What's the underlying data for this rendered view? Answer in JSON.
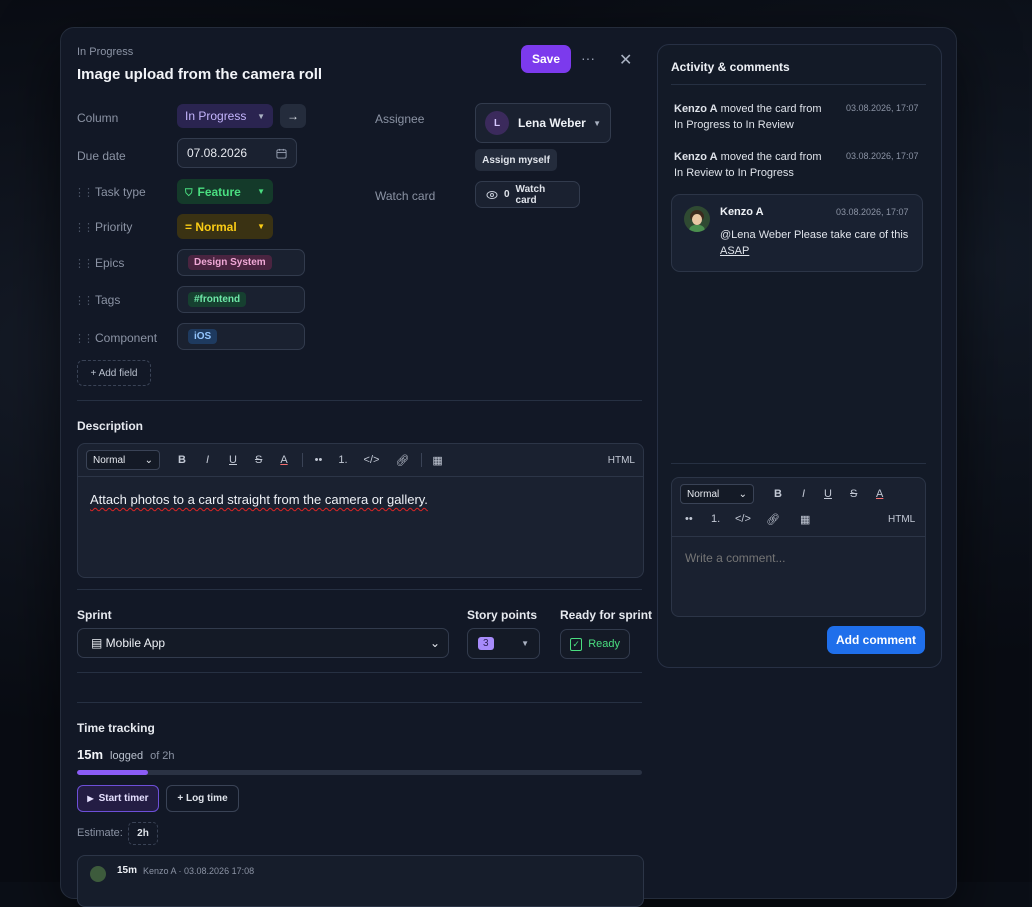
{
  "card": {
    "status": "In Progress",
    "title": "Image upload from the camera roll",
    "save_label": "Save",
    "more_label": "···",
    "close_label": "✕"
  },
  "fields": {
    "column_label": "Column",
    "column_value": "In Progress",
    "move_arrow": "→",
    "due_label": "Due date",
    "due_value": "07.08.2026",
    "task_type_label": "Task type",
    "task_type_value": "Feature",
    "priority_label": "Priority",
    "priority_value": "= Normal",
    "epics_label": "Epics",
    "epics_value": "Design System",
    "tags_label": "Tags",
    "tags_value": "#frontend",
    "component_label": "Component",
    "component_value": "iOS",
    "add_field_label": "+ Add field",
    "assignee_label": "Assignee",
    "assignee_initial": "L",
    "assignee_name": "Lena Weber",
    "assign_myself_label": "Assign myself",
    "watch_label": "Watch card",
    "watch_count": "0",
    "watch_button_label": "Watch card"
  },
  "description": {
    "title": "Description",
    "format_value": "Normal",
    "html_label": "HTML",
    "text": "Attach photos to a card straight from the camera or gallery."
  },
  "sprint": {
    "sprint_label": "Sprint",
    "sprint_value": "▤ Mobile App",
    "story_label": "Story points",
    "story_value": "3",
    "ready_label": "Ready for sprint",
    "ready_value": "Ready"
  },
  "time": {
    "title": "Time tracking",
    "logged_value": "15m",
    "logged_word": "logged",
    "of_total": "of 2h",
    "progress_fraction": 0.125,
    "start_timer_label": "Start timer",
    "log_time_label": "+ Log time",
    "estimate_label": "Estimate:",
    "estimate_value": "2h",
    "entry_duration": "15m",
    "entry_meta": "Kenzo A · 03.08.2026 17:08"
  },
  "activity": {
    "title": "Activity & comments",
    "items": [
      {
        "user": "Kenzo A",
        "text": " moved the card from",
        "text2": "In Progress to In Review",
        "date": "03.08.2026, 17:07"
      },
      {
        "user": "Kenzo A",
        "text": " moved the card from",
        "text2": "In Review to In Progress",
        "date": "03.08.2026, 17:07"
      }
    ],
    "comment": {
      "user": "Kenzo A",
      "date": "03.08.2026, 17:07",
      "text": "@Lena Weber Please take care of this",
      "link": "ASAP"
    },
    "format_value": "Normal",
    "html_label": "HTML",
    "placeholder": "Write a comment...",
    "add_comment_label": "Add comment"
  },
  "colors": {
    "accent": "#7c3aed",
    "blue_button": "#1f6feb",
    "feature_green": "#4ade80",
    "priority_yellow": "#facc15"
  }
}
